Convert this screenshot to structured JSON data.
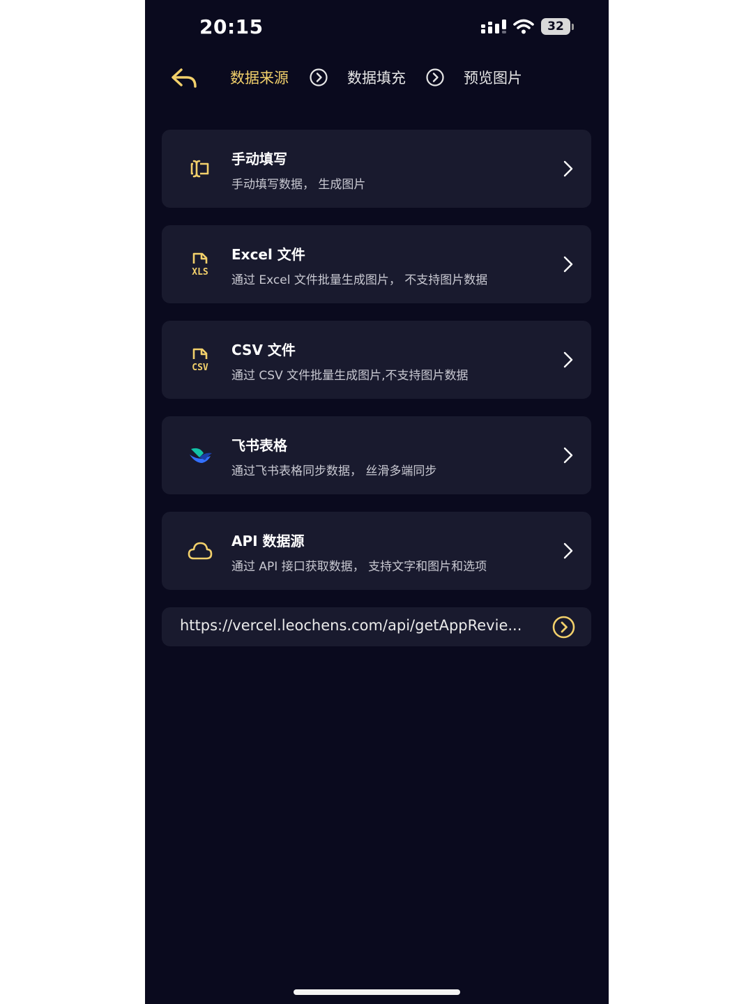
{
  "status_bar": {
    "time": "20:15",
    "battery": "32"
  },
  "steps": [
    {
      "label": "数据来源",
      "active": true
    },
    {
      "label": "数据填充",
      "active": false
    },
    {
      "label": "预览图片",
      "active": false
    }
  ],
  "sources": [
    {
      "title": "手动填写",
      "description": "手动填写数据， 生成图片",
      "icon": "text-cursor-icon"
    },
    {
      "title": "Excel 文件",
      "description": "通过 Excel 文件批量生成图片， 不支持图片数据",
      "icon": "xls-file-icon"
    },
    {
      "title": "CSV 文件",
      "description": "通过 CSV 文件批量生成图片,不支持图片数据",
      "icon": "csv-file-icon"
    },
    {
      "title": "飞书表格",
      "description": "通过飞书表格同步数据， 丝滑多端同步",
      "icon": "feishu-logo-icon"
    },
    {
      "title": "API 数据源",
      "description": "通过 API 接口获取数据， 支持文字和图片和选项",
      "icon": "cloud-icon"
    }
  ],
  "url_bar": {
    "value": "https://vercel.leochens.com/api/getAppRevie..."
  },
  "colors": {
    "background": "#0a0a1e",
    "card": "#191a2e",
    "accent": "#f2d06b"
  }
}
